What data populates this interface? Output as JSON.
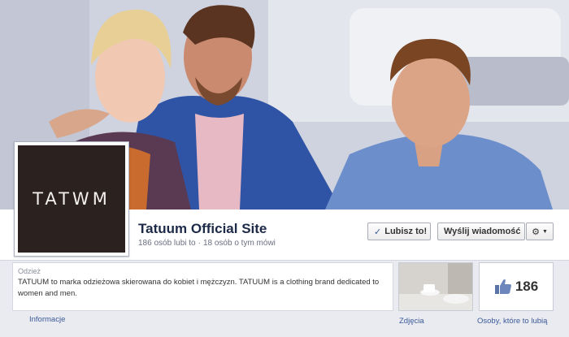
{
  "page": {
    "logo_text": "TATWM",
    "title": "Tatuum Official Site",
    "likes_text": "186 osób lubi to",
    "talking_text": "18 osób o tym mówi",
    "separator": "·"
  },
  "actions": {
    "like_check": "✓",
    "like_label": "Lubisz to!",
    "message_label": "Wyślij wiadomość",
    "gear_icon": "⚙",
    "caret_icon": "▼"
  },
  "about": {
    "category": "Odzież",
    "description": "TATUUM to marka odzieżowa skierowana do kobiet i mężczyzn. TATUUM is a clothing brand dedicated to women and men.",
    "link_label": "Informacje"
  },
  "tiles": {
    "photos_label": "Zdjęcia",
    "likes_count": "186",
    "likes_label": "Osoby, które to lubią"
  },
  "colors": {
    "link": "#3b5998",
    "title": "#1c2a47",
    "strip": "#e9ebf1",
    "logo_bg": "#2b221f"
  },
  "icons": [
    "check-icon",
    "gear-icon",
    "chevron-down-icon",
    "thumbs-up-icon"
  ]
}
